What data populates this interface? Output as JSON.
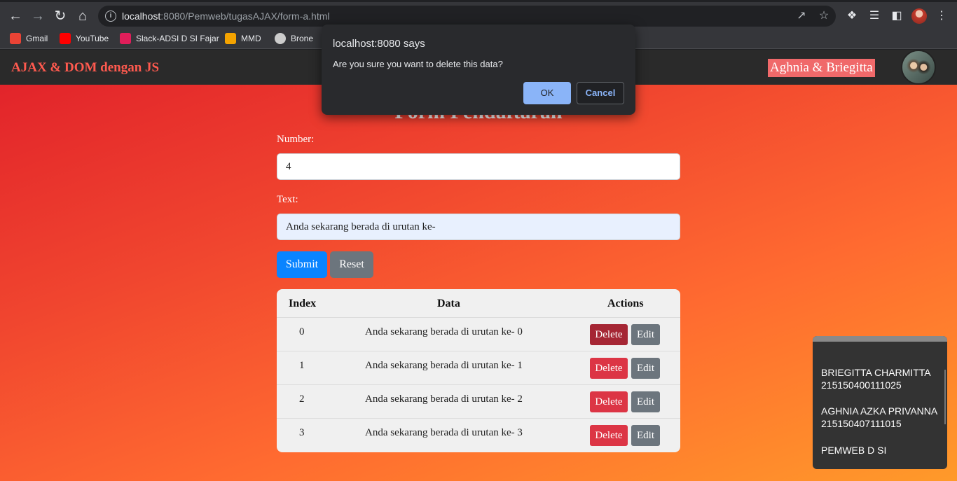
{
  "browser": {
    "url_host": "localhost",
    "url_path": ":8080/Pemweb/tugasAJAX/form-a.html",
    "bookmarks": [
      {
        "label": "Gmail",
        "icon": "gmail-icon",
        "color": "#ea4335"
      },
      {
        "label": "YouTube",
        "icon": "youtube-icon",
        "color": "#ff0000"
      },
      {
        "label": "Slack-ADSI D SI Fajar",
        "icon": "slack-icon",
        "color": "#e01e5a"
      },
      {
        "label": "MMD",
        "icon": "mmd-icon",
        "color": "#f4a300"
      },
      {
        "label": "Brone",
        "icon": "brone-icon",
        "color": "#cccccc"
      }
    ]
  },
  "dialog": {
    "title": "localhost:8080 says",
    "message": "Are you sure you want to delete this data?",
    "ok_label": "OK",
    "cancel_label": "Cancel"
  },
  "site": {
    "title": "AJAX & DOM dengan JS",
    "authors": "Aghnia & Briegitta"
  },
  "form": {
    "title": "Form Pendaftaran",
    "number_label": "Number:",
    "number_value": "4",
    "text_label": "Text:",
    "text_value": "Anda sekarang berada di urutan ke-",
    "submit_label": "Submit",
    "reset_label": "Reset"
  },
  "table": {
    "headers": {
      "index": "Index",
      "data": "Data",
      "actions": "Actions"
    },
    "delete_label": "Delete",
    "edit_label": "Edit",
    "rows": [
      {
        "index": "0",
        "data": "Anda sekarang berada di urutan ke- 0"
      },
      {
        "index": "1",
        "data": "Anda sekarang berada di urutan ke- 1"
      },
      {
        "index": "2",
        "data": "Anda sekarang berada di urutan ke- 2"
      },
      {
        "index": "3",
        "data": "Anda sekarang berada di urutan ke- 3"
      }
    ]
  },
  "info": {
    "person1_name": "BRIEGITTA CHARMITTA",
    "person1_id": "215150400111025",
    "person2_name": "AGHNIA AZKA PRIVANNA",
    "person2_id": "215150407111015",
    "class": "PEMWEB D SI"
  }
}
